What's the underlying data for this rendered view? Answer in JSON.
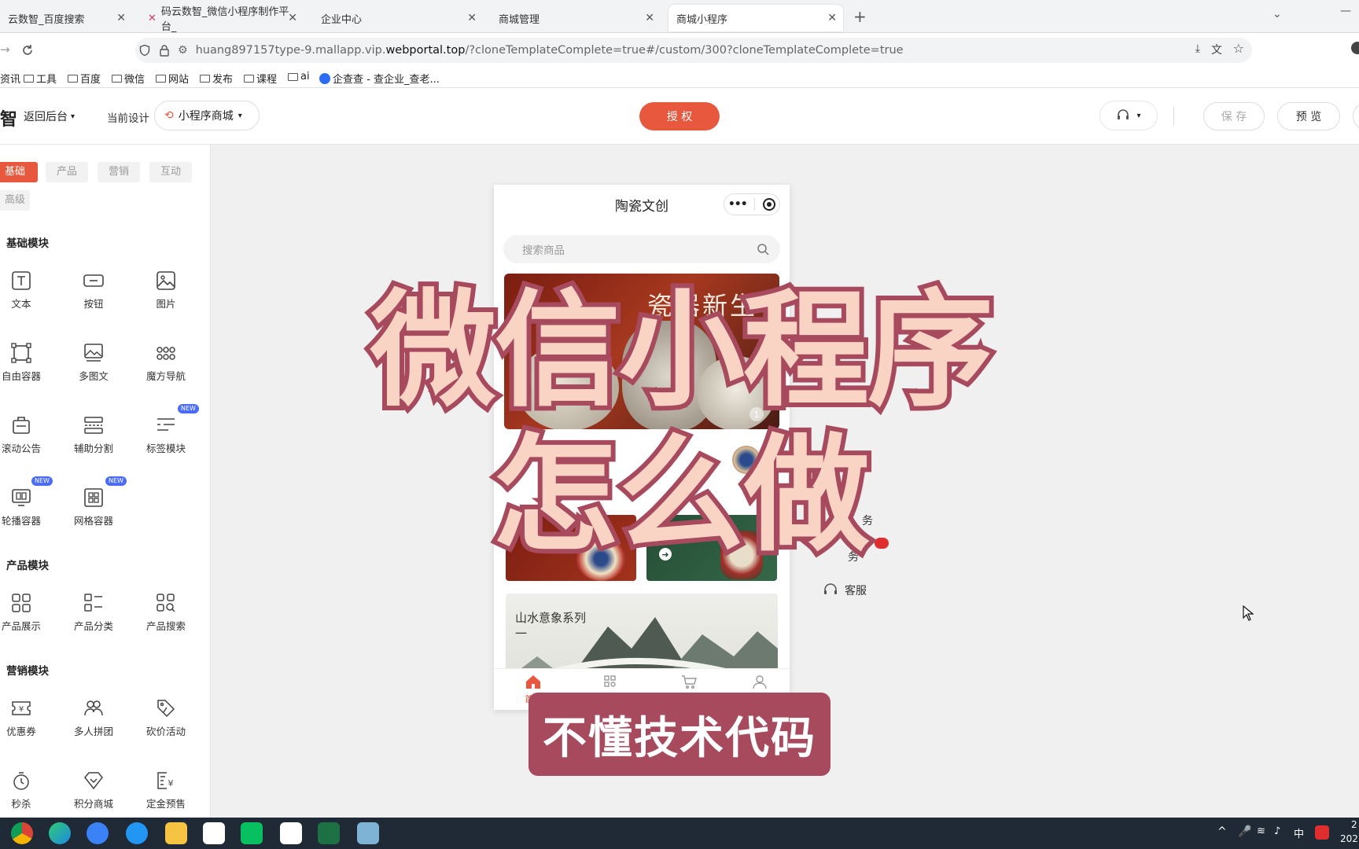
{
  "browser": {
    "tabs": [
      {
        "label": "云数智_百度搜索"
      },
      {
        "label": "码云数智_微信小程序制作平台_"
      },
      {
        "label": "企业中心"
      },
      {
        "label": "商城管理"
      },
      {
        "label": "商城小程序"
      }
    ],
    "url": {
      "pre": "huang897157type-9.mallapp.vip.",
      "domain": "webportal.top",
      "rest": "/?cloneTemplateComplete=true#/custom/300?cloneTemplateComplete=true"
    },
    "bookmarks": [
      "资讯",
      "工具",
      "百度",
      "微信",
      "网站",
      "发布",
      "课程",
      "ai",
      "企查查 - 查企业_查老..."
    ]
  },
  "header": {
    "logo_char": "智",
    "back": "返回后台",
    "current_design_label": "当前设计",
    "design_select": "小程序商城",
    "authorize": "授 权",
    "save": "保 存",
    "preview": "预 览"
  },
  "sidebar": {
    "categories": [
      "基础",
      "产品",
      "营销",
      "互动",
      "高级"
    ],
    "sections": {
      "basic": "基础模块",
      "product": "产品模块",
      "marketing": "营销模块"
    },
    "basic_blocks": [
      "文本",
      "按钮",
      "图片",
      "自由容器",
      "多图文",
      "魔方导航",
      "滚动公告",
      "辅助分割",
      "标签模块",
      "轮播容器",
      "网格容器"
    ],
    "product_blocks": [
      "产品展示",
      "产品分类",
      "产品搜索"
    ],
    "marketing_blocks": [
      "优惠券",
      "多人拼团",
      "砍价活动",
      "秒杀",
      "积分商城",
      "定金预售"
    ],
    "new_badge": "NEW"
  },
  "phone": {
    "title": "陶瓷文创",
    "search_placeholder": "搜索商品",
    "banner_title": "瓷器新生",
    "banner_index": "1",
    "shanshui_title": "山水意象系列",
    "shanshui_sub": "一",
    "tabbar": [
      "首页",
      "分类",
      "购物车",
      "我的"
    ]
  },
  "side_menu": {
    "item_partial_1": "务",
    "item_partial_2": "务",
    "service": "客服"
  },
  "overlay": {
    "line1": "微信小程序",
    "line2": "怎么做",
    "caption": "不懂技术代码"
  },
  "taskbar": {
    "tray_lang": "中",
    "clock_time": "2",
    "clock_date": "202"
  },
  "colors": {
    "accent": "#e8583f",
    "overlay_stroke": "#a84a5e",
    "overlay_fill": "#f9d3c4",
    "caption_bg": "#a84a5e"
  }
}
